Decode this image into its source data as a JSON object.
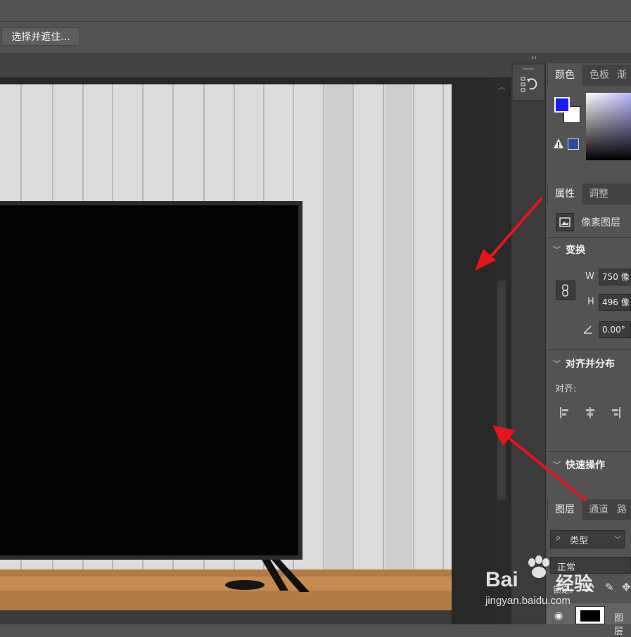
{
  "options_bar": {
    "select_mask_label": "选择并遮住..."
  },
  "right_column": {
    "collapse_label": "‹‹"
  },
  "color_panel": {
    "tabs": [
      "颜色",
      "色板",
      "渐"
    ],
    "foreground_color": "#1a1aff",
    "background_color": "#ffffff",
    "warning_swatch_color": "#2b4aa8"
  },
  "properties_panel": {
    "tabs": [
      "属性",
      "调整"
    ],
    "layer_kind": "像素图层",
    "transform": {
      "header": "变换",
      "w_label": "W",
      "w_value": "750 像",
      "h_label": "H",
      "h_value": "496 像",
      "angle_value": "0.00°"
    },
    "align": {
      "header": "对齐并分布",
      "label": "对齐:"
    },
    "quick_actions": {
      "header": "快速操作"
    }
  },
  "layers_panel": {
    "tabs": [
      "图层",
      "通道",
      "路"
    ],
    "filter_label": "类型",
    "blend_mode": "正常",
    "lock_label": "锁定:",
    "layer_name": "图层"
  },
  "watermark": {
    "brand": "Bai",
    "brand2": "经验",
    "url": "jingyan.baidu.com"
  },
  "annotation_color": "#e8141b"
}
